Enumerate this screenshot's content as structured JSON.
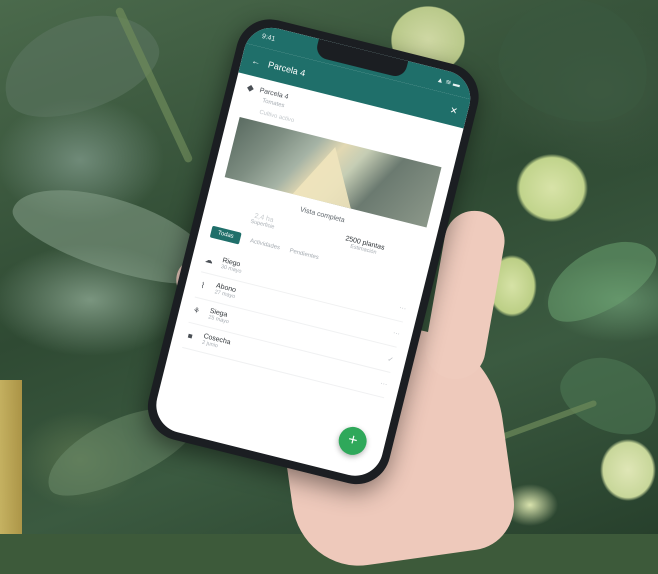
{
  "colors": {
    "brand": "#1f6f6a",
    "fab": "#2fa85a"
  },
  "status": {
    "time": "9:41",
    "signal": "▲ ≋ ▬"
  },
  "appbar": {
    "title": "Parcela 4",
    "back_icon": "arrow-left-icon",
    "close_icon": "close-icon"
  },
  "parcel": {
    "name": "Parcela 4",
    "sub1": "Tomates",
    "sub2": "Cultivo activo"
  },
  "map_label": "Vista completa",
  "stats": [
    {
      "value": "2,4 ha",
      "label": "Superficie"
    },
    {
      "value": "2500 plantas",
      "label": "Estimación"
    }
  ],
  "tabs": {
    "active": "Todas",
    "others": [
      "Actividades",
      "Pendientes"
    ]
  },
  "list": [
    {
      "icon": "cloud-icon",
      "title": "Riego",
      "subtitle": "30 mayo",
      "trail": "···"
    },
    {
      "icon": "spray-icon",
      "title": "Abono",
      "subtitle": "27 mayo",
      "trail": "···"
    },
    {
      "icon": "sprout-icon",
      "title": "Siega",
      "subtitle": "25 mayo",
      "trail": "✓"
    },
    {
      "icon": "box-icon",
      "title": "Cosecha",
      "subtitle": "2 junio",
      "trail": "···"
    }
  ],
  "fab_label": "+"
}
